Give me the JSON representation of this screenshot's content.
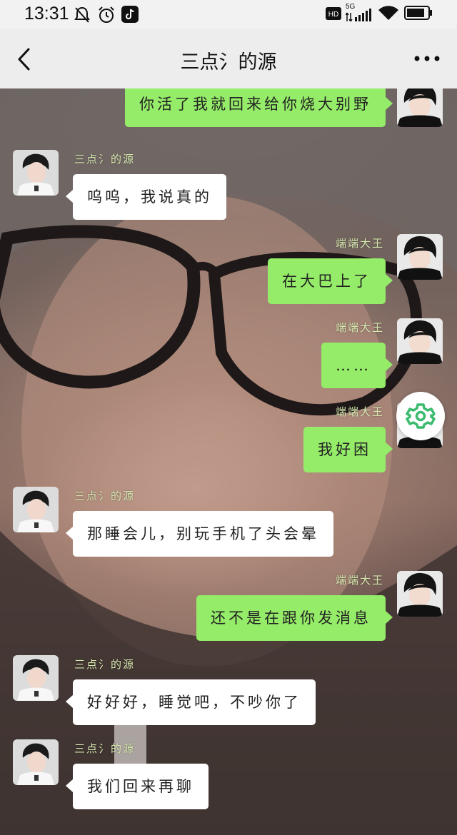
{
  "status_bar": {
    "time": "13:31",
    "hd_label": "HD",
    "network": "5G",
    "icons": [
      "mute-bell-icon",
      "alarm-icon",
      "tiktok-icon",
      "signal-icon",
      "wifi-icon",
      "battery-icon"
    ]
  },
  "nav": {
    "title": "三点氵的源",
    "back_icon": "chevron-left-icon",
    "more_icon": "more-dots-icon"
  },
  "messages": [
    {
      "side": "me",
      "sender": "",
      "text": "你活了我就回来给你烧大别野"
    },
    {
      "side": "other",
      "sender": "三点氵的源",
      "text": "呜呜，我说真的"
    },
    {
      "side": "me",
      "sender": "端端大王",
      "text": "在大巴上了"
    },
    {
      "side": "me",
      "sender": "端端大王",
      "text": "……"
    },
    {
      "side": "me",
      "sender": "端端大王",
      "text": "我好困"
    },
    {
      "side": "other",
      "sender": "三点氵的源",
      "text": "那睡会儿，别玩手机了头会晕"
    },
    {
      "side": "me",
      "sender": "端端大王",
      "text": "还不是在跟你发消息"
    },
    {
      "side": "other",
      "sender": "三点氵的源",
      "text": "好好好，睡觉吧，不吵你了"
    },
    {
      "side": "other",
      "sender": "三点氵的源",
      "text": "我们回来再聊"
    }
  ],
  "floating_button": {
    "icon": "gear-icon"
  },
  "colors": {
    "my_bubble": "#95ec69",
    "other_bubble": "#ffffff",
    "sender_name": "#d8e9b0",
    "fab_icon": "#3cba6e"
  }
}
